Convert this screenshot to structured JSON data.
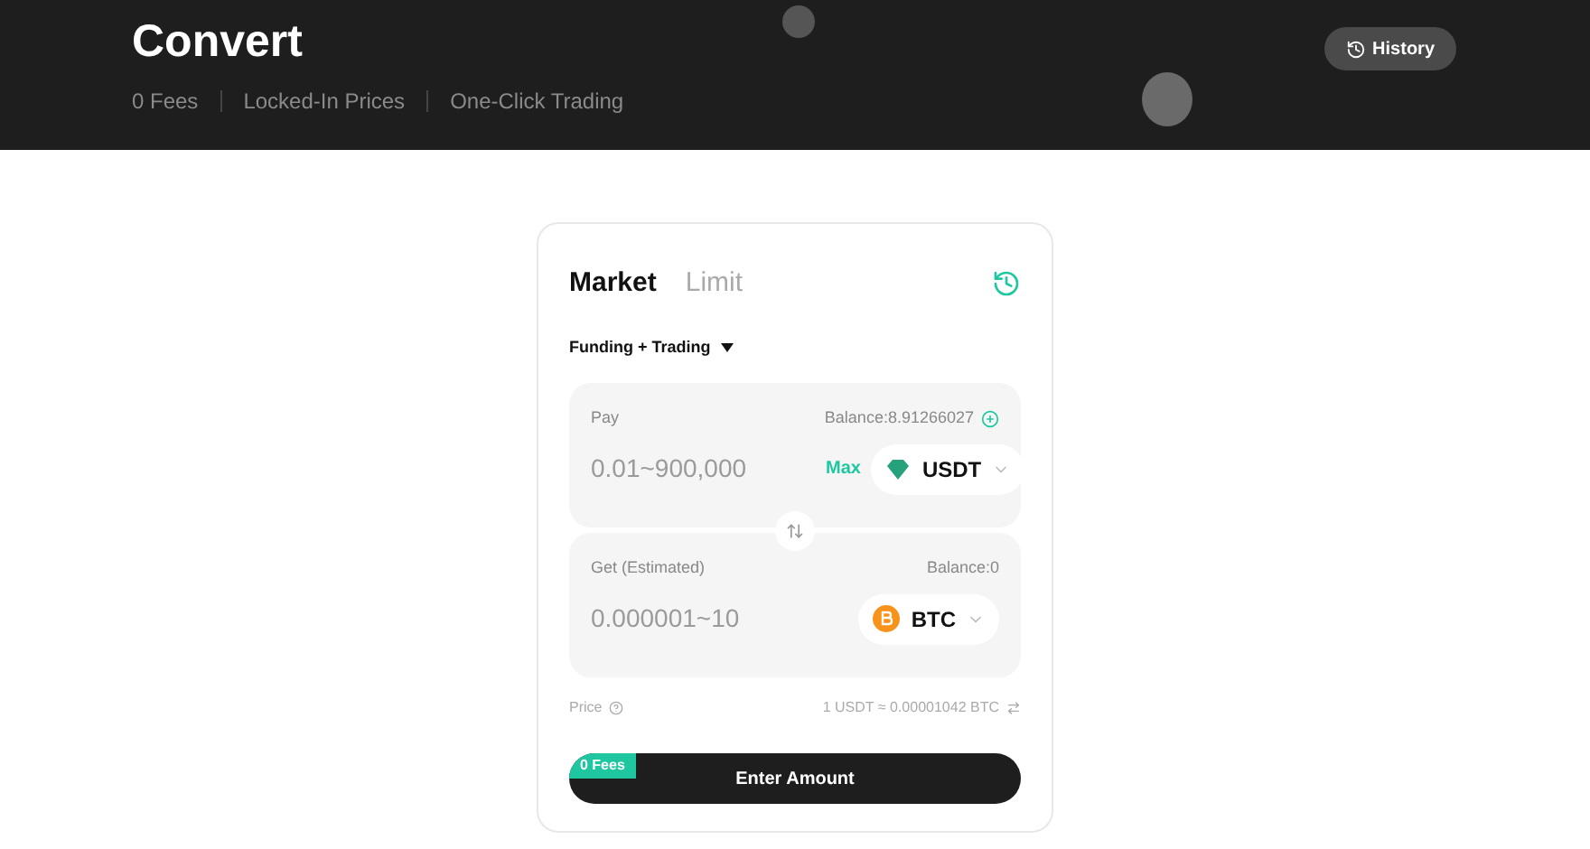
{
  "header": {
    "title": "Convert",
    "features": [
      "0 Fees",
      "Locked-In Prices",
      "One-Click Trading"
    ],
    "history_button": "History"
  },
  "tabs": [
    {
      "label": "Market",
      "selected": true
    },
    {
      "label": "Limit",
      "selected": false
    }
  ],
  "account_selector": "Funding + Trading",
  "pay": {
    "label": "Pay",
    "balance": "Balance:8.91266027",
    "placeholder": "0.01~900,000",
    "max": "Max",
    "currency": {
      "kind": "usdt",
      "label": "USDT"
    }
  },
  "get": {
    "label": "Get (Estimated)",
    "balance": "Balance:0",
    "placeholder": "0.000001~10",
    "currency": {
      "kind": "btc",
      "label": "BTC"
    }
  },
  "price": {
    "label": "Price",
    "rate": "1 USDT ≈ 0.00001042 BTC"
  },
  "submit": {
    "label": "Enter Amount",
    "badge": "0 Fees"
  }
}
